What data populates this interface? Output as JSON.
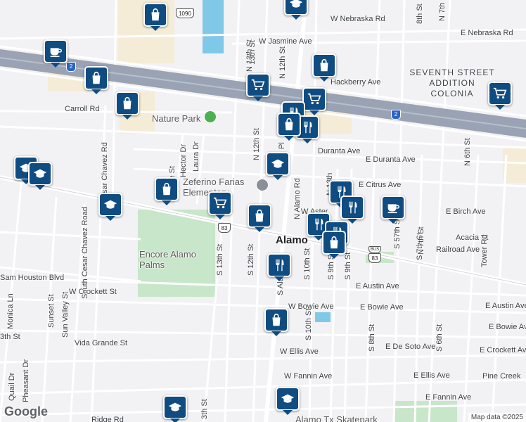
{
  "streets": {
    "w_nebraska": "W Nebraska Rd",
    "e_nebraska": "E Nebraska Rd",
    "w_jasmine": "W Jasmine Ave",
    "hackberry": "Hackberry Ave",
    "carroll": "Carroll Rd",
    "duranta": "Duranta Ave",
    "e_duranta": "E Duranta Ave",
    "e_citrus": "E Citrus Ave",
    "w_aster": "W Aster",
    "e_birch": "E Birch Ave",
    "acacia": "Acacia St",
    "railroad": "Railroad Ave",
    "sam_houston": "Sam Houston Blvd",
    "w_crockett": "W Crockett St",
    "e_austin": "E Austin Ave",
    "e_austin_2": "E Austin Ave",
    "e_bowie": "E Bowie Ave",
    "e_bowie_2": "E Bowie Ave",
    "w_bowie": "W Bowie Ave",
    "vida_grande": "Vida Grande St",
    "e_de_soto": "E De Soto Ave",
    "e_crockett": "E Crockett Ave",
    "w_ellis": "W Ellis Ave",
    "e_ellis": "E Ellis Ave",
    "w_fannin": "W Fannin Ave",
    "e_fannin": "E Fannin Ave",
    "pine_creek": "Pine Creek",
    "ridge": "Ridge Rd",
    "n13": "N 13th St",
    "n13b": "13th St",
    "n12": "N 12th St",
    "n12b": "N 12th St",
    "n13c": "N 13th",
    "s13": "S 13th St",
    "s12": "S 12th St",
    "n_alamo": "N Alamo Rd",
    "s_alamo": "S Alamo Rd",
    "s10": "S 10th St",
    "s10b": "S 10th St",
    "s9": "S 9th St",
    "s9b": "S 9th St",
    "s8": "S 8th St",
    "s7": "S 7th St",
    "s6": "S 6th St",
    "s57": "S 57th St",
    "n7": "N 7th St",
    "n6": "N 6th St",
    "n8": "8th St",
    "n7b": "N 7th",
    "tower": "Tower Rd",
    "cesar_chavez_n": "N Cesar Chavez Rd",
    "cesar_chavez_s": "South Cesar Chavez Road",
    "sunset": "Sunset St",
    "sun_valley": "Sun Valley St",
    "monica": "Monica Ln",
    "quail": "Quail Dr",
    "pheasant": "Pheasant Dr",
    "laura": "Laura Dr",
    "hector": "Hector Dr",
    "eie": "ie St",
    "third": "3th St",
    "third_b": "3th St",
    "pl": "Pl"
  },
  "places": {
    "nature_park": "Nature Park",
    "school": "Zeferino Farias Elementary",
    "city": "Alamo",
    "encore": "Encore Alamo Palms",
    "colonia": "SEVENTH STREET ADDITION COLONIA",
    "skatepark": "Alamo Tx Skatepark"
  },
  "shields": {
    "fm1090": "1090",
    "i2_left": "2",
    "i2_right": "2",
    "us83": "83",
    "bus": "BUS",
    "bus83": "83"
  },
  "markers": [
    {
      "id": "shop-1",
      "icon": "shopping-bag-icon"
    },
    {
      "id": "school-1",
      "icon": "school-icon"
    },
    {
      "id": "cafe-1",
      "icon": "coffee-cup-icon"
    },
    {
      "id": "shop-2",
      "icon": "shopping-bag-icon"
    },
    {
      "id": "grocery-1",
      "icon": "shopping-cart-icon"
    },
    {
      "id": "shop-3",
      "icon": "shopping-bag-icon"
    },
    {
      "id": "shop-4",
      "icon": "shopping-bag-icon"
    },
    {
      "id": "grocery-2",
      "icon": "shopping-cart-icon"
    },
    {
      "id": "restaurant-1",
      "icon": "fork-knife-icon"
    },
    {
      "id": "restaurant-2",
      "icon": "fork-knife-icon"
    },
    {
      "id": "shop-5",
      "icon": "shopping-bag-icon"
    },
    {
      "id": "school-2",
      "icon": "school-icon"
    },
    {
      "id": "school-3",
      "icon": "school-icon"
    },
    {
      "id": "school-4",
      "icon": "school-icon"
    },
    {
      "id": "school-5",
      "icon": "school-icon"
    },
    {
      "id": "shop-6",
      "icon": "shopping-bag-icon"
    },
    {
      "id": "grocery-3",
      "icon": "shopping-cart-icon"
    },
    {
      "id": "shop-7",
      "icon": "shopping-bag-icon"
    },
    {
      "id": "restaurant-3",
      "icon": "fork-knife-icon"
    },
    {
      "id": "restaurant-4",
      "icon": "fork-knife-icon"
    },
    {
      "id": "cafe-2",
      "icon": "coffee-cup-icon"
    },
    {
      "id": "restaurant-5",
      "icon": "fork-knife-icon"
    },
    {
      "id": "restaurant-6",
      "icon": "fork-knife-icon"
    },
    {
      "id": "shop-8",
      "icon": "shopping-bag-icon"
    },
    {
      "id": "restaurant-7",
      "icon": "fork-knife-icon"
    },
    {
      "id": "shop-9",
      "icon": "shopping-bag-icon"
    },
    {
      "id": "school-6",
      "icon": "school-icon"
    },
    {
      "id": "school-7",
      "icon": "school-icon"
    },
    {
      "id": "grocery-4",
      "icon": "shopping-cart-icon"
    }
  ],
  "google_logo": "Google",
  "attribution": "Map data ©2025",
  "colors": {
    "background": "#f2f1f4",
    "pin": "#0f4c81",
    "highway": "#9aa3b4",
    "park": "#c8e6c9",
    "water": "#7fc8e8",
    "commercial": "#f5ecd7"
  }
}
